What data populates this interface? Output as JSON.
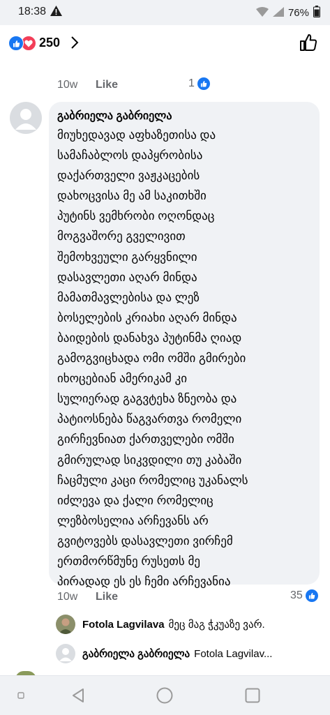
{
  "status_bar": {
    "time": "18:38",
    "warning_icon": "warning-triangle-icon",
    "battery": "76%"
  },
  "reactions": {
    "count": "250",
    "icons": [
      "like-icon",
      "love-icon"
    ],
    "like_color": "#1877f2",
    "love_color": "#f33e58"
  },
  "prev_comment": {
    "time_ago": "10w",
    "like_label": "Like",
    "reaction_count": "1"
  },
  "comment": {
    "author": "გაბრიელა გაბრიელა",
    "body": "მიუხედავად აფხაზეთისა და\nსამაჩაბლოს  დაპყრობისა\nდაქართველი ვაჟკაცების\nდახოცვისა  მე ამ საკითხში\nპუტინს ვემხრობი ოღონდაც\nმოგვაშორე გველივით\nშემოხვეული გარყვნილი\nდასავლეთი აღარ მინდა\nმამათმავლებისა და ლეზ\nბოსელების კრიახი  აღარ მინდა\nბაიდების დანახვა  პუტინმა ღიად\nგამოგვიცხადა ომი ომში გმირები\nიხოცებიან ამერიკამ კი\nსულიერად გაგვტეხა ზნეობა და\nპატიოსნება წაგვართვა რომელი\nგირჩევნიათ ქართველები ომში\nგმირულად სიკვდილი თუ კაბაში\nჩაცმული კაცი რომელიც უკანალს\nიძლევა და ქალი რომელიც\nლეზბოსელია არჩევანს არ\nგვიტოვებს დასავლეთი ვირჩემ\nერთმორწმუნე რუსეთს მე\nპირადად ეს ეს ჩემი არჩევანია",
    "time_ago": "10w",
    "like_label": "Like",
    "reaction_count": "35"
  },
  "replies": [
    {
      "author": "Fotola Lagvilava",
      "text": "მეც მაგ ჭკუაზე ვარ."
    },
    {
      "author": "გაბრიელა გაბრიელა",
      "text": "Fotola Lagvilav..."
    }
  ]
}
